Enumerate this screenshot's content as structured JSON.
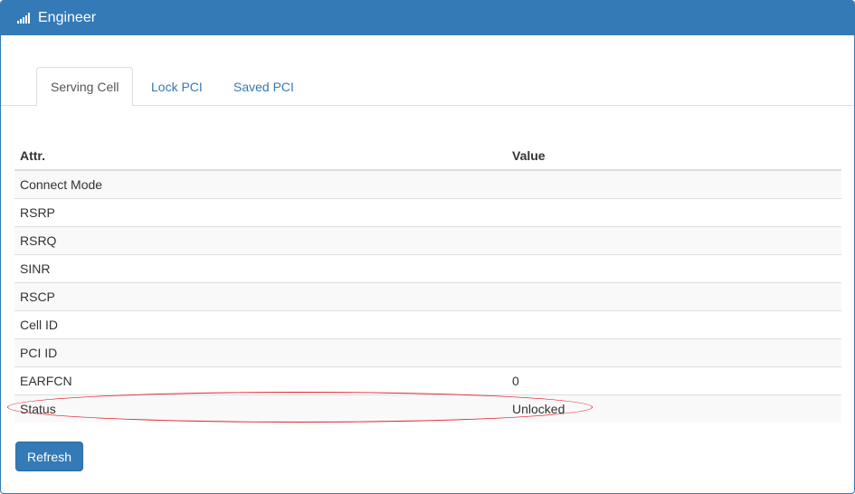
{
  "header": {
    "title": "Engineer",
    "icon": "signal-bars-icon"
  },
  "tabs": [
    {
      "label": "Serving Cell",
      "active": true
    },
    {
      "label": "Lock PCI",
      "active": false
    },
    {
      "label": "Saved PCI",
      "active": false
    }
  ],
  "table": {
    "columns": [
      "Attr.",
      "Value"
    ],
    "rows": [
      {
        "attr": "Connect Mode",
        "value": ""
      },
      {
        "attr": "RSRP",
        "value": ""
      },
      {
        "attr": "RSRQ",
        "value": ""
      },
      {
        "attr": "SINR",
        "value": ""
      },
      {
        "attr": "RSCP",
        "value": ""
      },
      {
        "attr": "Cell ID",
        "value": ""
      },
      {
        "attr": "PCI ID",
        "value": ""
      },
      {
        "attr": "EARFCN",
        "value": "0"
      },
      {
        "attr": "Status",
        "value": "Unlocked"
      }
    ]
  },
  "refresh_label": "Refresh",
  "colors": {
    "primary": "#337ab7",
    "annotation": "#e0242f"
  }
}
